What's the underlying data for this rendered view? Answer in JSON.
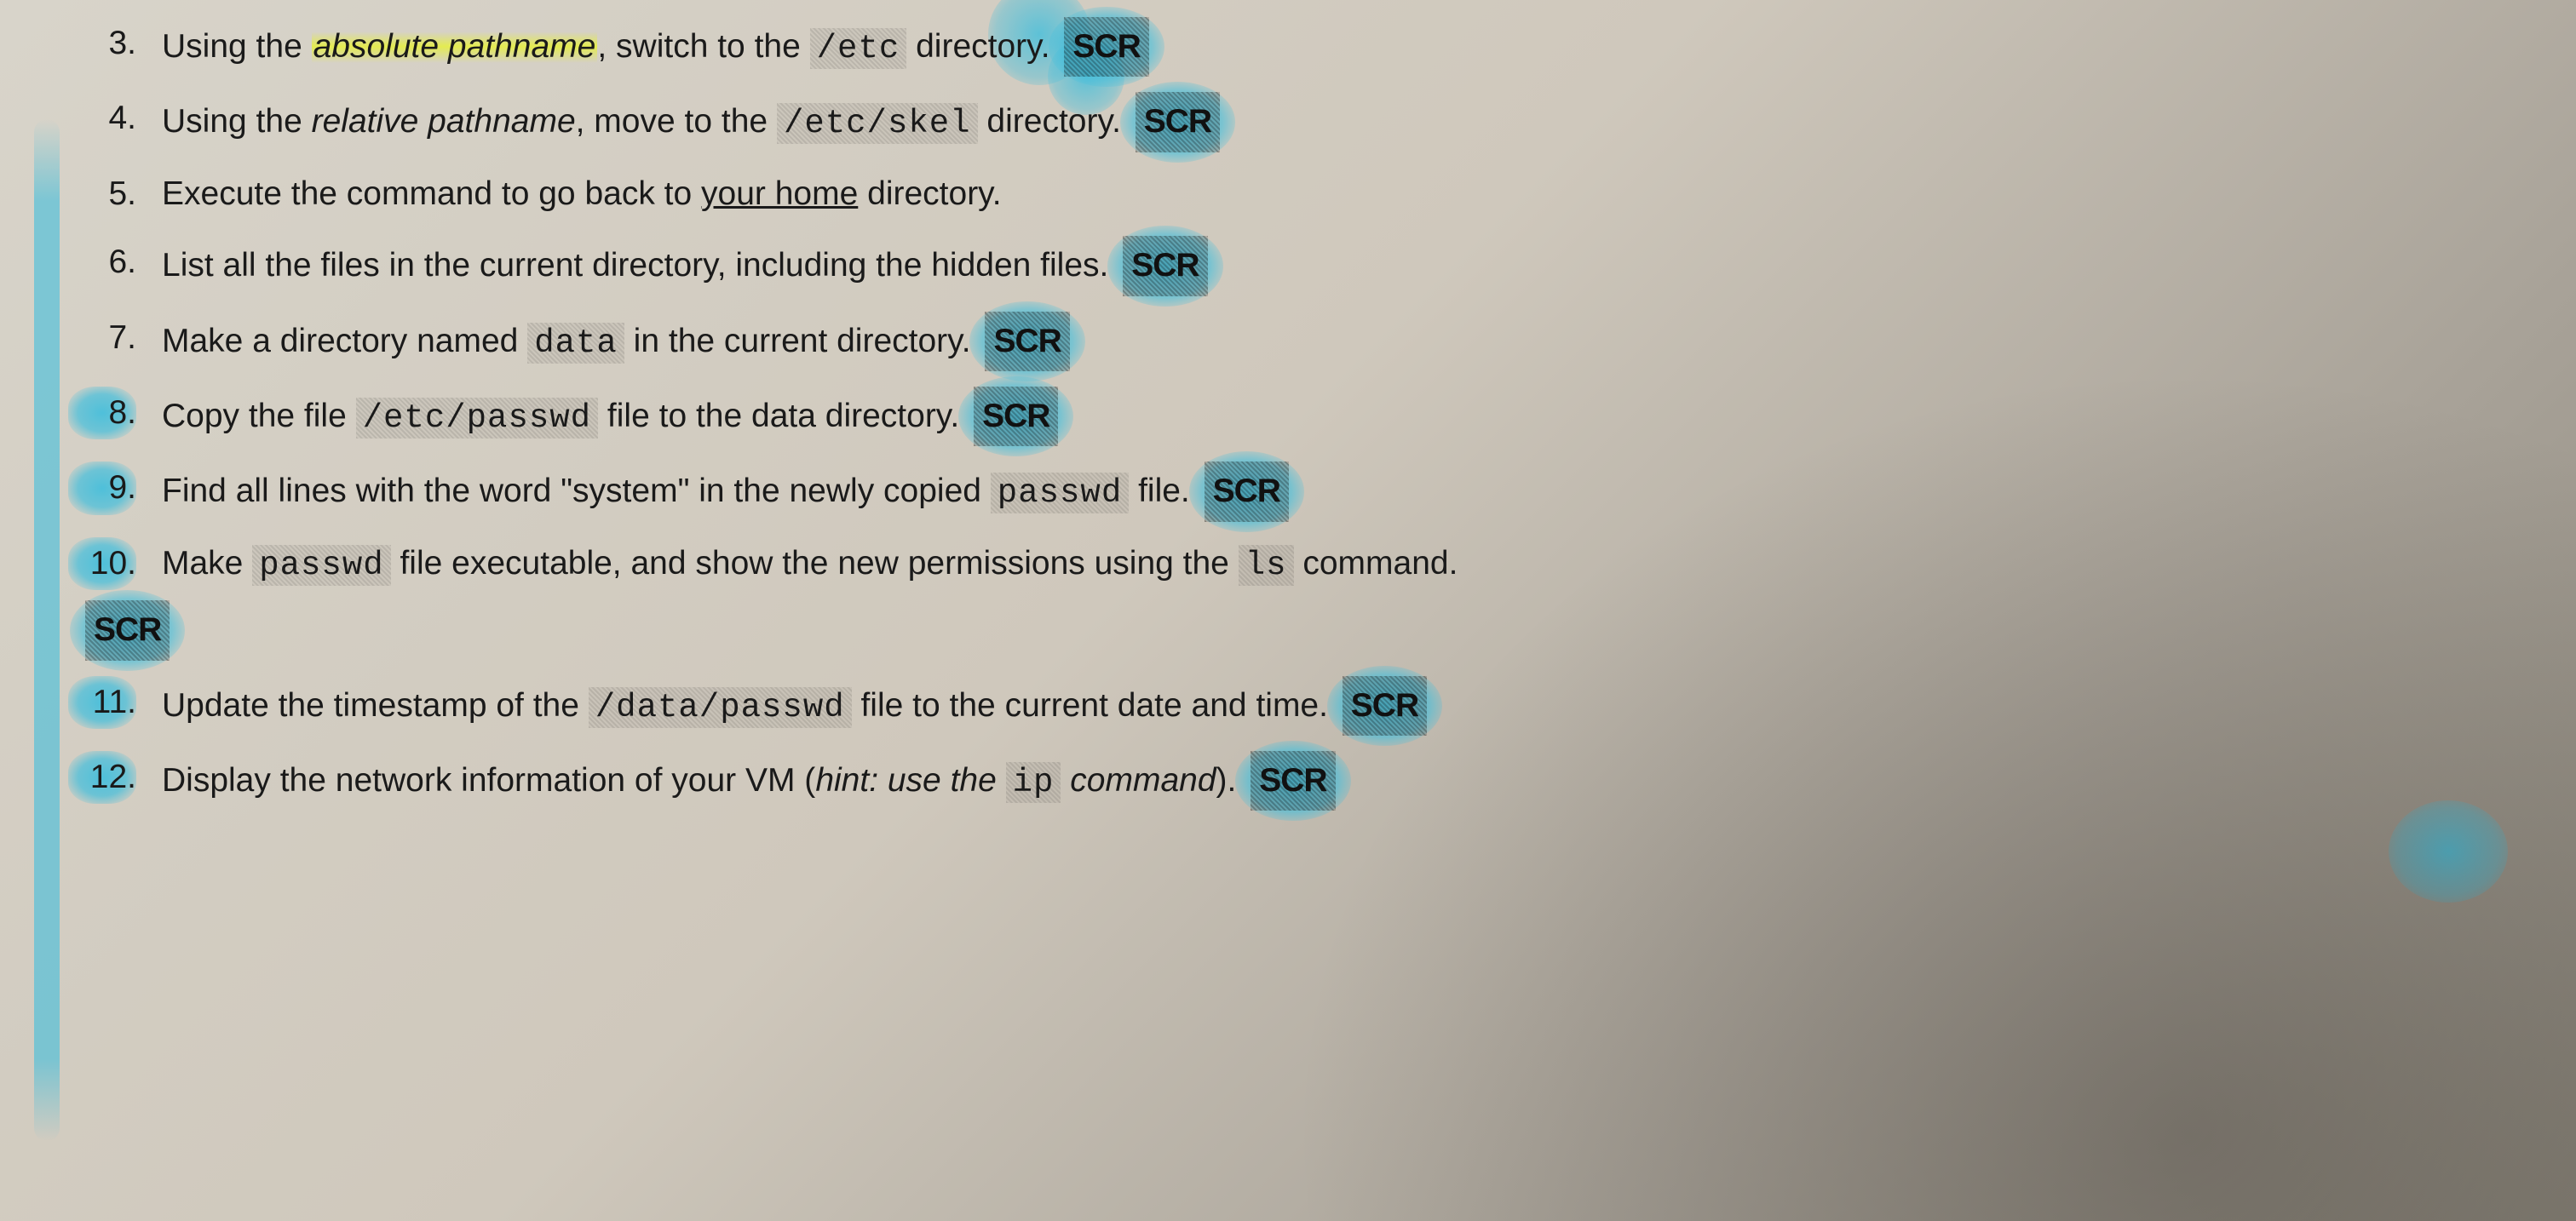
{
  "scr_label": "SCR",
  "items": [
    {
      "parts": [
        {
          "t": "Using the "
        },
        {
          "t": "absolute pathname",
          "cls": "italic hl-yellow"
        },
        {
          "t": ", switch to the "
        },
        {
          "t": "/etc",
          "cls": "code"
        },
        {
          "t": " directory. "
        }
      ],
      "scr": true,
      "scr_blue": true
    },
    {
      "parts": [
        {
          "t": "Using the "
        },
        {
          "t": "relative pathname",
          "cls": "italic"
        },
        {
          "t": ", move to the "
        },
        {
          "t": "/etc/skel",
          "cls": "code"
        },
        {
          "t": " directory. "
        }
      ],
      "scr": true,
      "scr_blue": true
    },
    {
      "parts": [
        {
          "t": "Execute the command to go back to "
        },
        {
          "t": "your home",
          "cls": "underline"
        },
        {
          "t": " directory."
        }
      ],
      "scr": false
    },
    {
      "parts": [
        {
          "t": "List all the files in the current directory, including the hidden files. "
        }
      ],
      "scr": true,
      "scr_blue": true
    },
    {
      "parts": [
        {
          "t": "Make a directory named "
        },
        {
          "t": "data",
          "cls": "code"
        },
        {
          "t": " in the current directory. "
        }
      ],
      "scr": true,
      "scr_blue": true
    },
    {
      "parts": [
        {
          "t": "Copy the file "
        },
        {
          "t": "/etc/passwd",
          "cls": "code"
        },
        {
          "t": " file to the data directory. "
        }
      ],
      "scr": true,
      "scr_blue": true,
      "num_hl": true
    },
    {
      "parts": [
        {
          "t": "Find all lines with the word \"system\" in the newly copied "
        },
        {
          "t": "passwd",
          "cls": "code"
        },
        {
          "t": " file. "
        }
      ],
      "scr": true,
      "scr_blue": true,
      "num_hl": true
    },
    {
      "parts": [
        {
          "t": "Make "
        },
        {
          "t": "passwd",
          "cls": "code"
        },
        {
          "t": " file executable, and show the new permissions using the "
        },
        {
          "t": "ls",
          "cls": "code"
        },
        {
          "t": " command."
        }
      ],
      "scr": true,
      "scr_blue": true,
      "scr_below": true,
      "num_hl": true
    },
    {
      "parts": [
        {
          "t": "Update the timestamp of the "
        },
        {
          "t": "/data/passwd",
          "cls": "code"
        },
        {
          "t": " file to the current date and time. "
        }
      ],
      "scr": true,
      "scr_blue": true,
      "num_hl": true
    },
    {
      "parts": [
        {
          "t": "Display the network information of your VM ("
        },
        {
          "t": "hint: use the ",
          "cls": "italic"
        },
        {
          "t": "ip",
          "cls": "code"
        },
        {
          "t": " command",
          "cls": "italic"
        },
        {
          "t": "). "
        }
      ],
      "scr": true,
      "scr_blue": true,
      "num_hl": true
    }
  ]
}
